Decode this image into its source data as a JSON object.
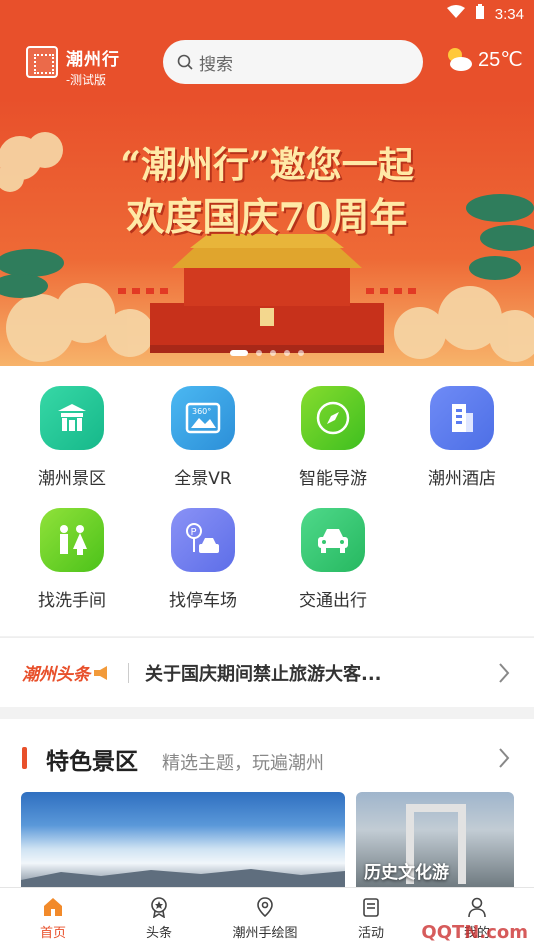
{
  "status_bar": {
    "time": "3:34"
  },
  "header": {
    "brand_title": "潮州行",
    "brand_subtitle": "-测试版",
    "search_placeholder": "搜索",
    "weather_temp": "25℃"
  },
  "banner": {
    "line1": "“潮州行”邀您一起",
    "line2": "欢度国庆70周年",
    "slide_count": 5,
    "active_slide": 1
  },
  "grid_items": [
    {
      "label": "潮州景区",
      "icon": "scenic-gate-icon",
      "color": "#22c497"
    },
    {
      "label": "全景VR",
      "icon": "vr-360-icon",
      "color": "#3fa6e8"
    },
    {
      "label": "智能导游",
      "icon": "compass-icon",
      "color": "#5bc828"
    },
    {
      "label": "潮州酒店",
      "icon": "hotel-building-icon",
      "color": "#5b7cf0"
    },
    {
      "label": "找洗手间",
      "icon": "restroom-icon",
      "color": "#64cc2a"
    },
    {
      "label": "找停车场",
      "icon": "parking-car-icon",
      "color": "#6f7ef0"
    },
    {
      "label": "交通出行",
      "icon": "car-icon",
      "color": "#34c870"
    }
  ],
  "news": {
    "tag": "潮州头条",
    "text": "关于国庆期间禁止旅游大客..."
  },
  "featured": {
    "title": "特色景区",
    "subtitle": "精选主题，玩遍潮州",
    "cards": [
      {
        "label": ""
      },
      {
        "label": "历史文化游"
      }
    ]
  },
  "tabbar": {
    "items": [
      {
        "label": "首页",
        "icon": "home-icon",
        "active": true
      },
      {
        "label": "头条",
        "icon": "news-badge-icon",
        "active": false
      },
      {
        "label": "潮州手绘图",
        "icon": "map-pin-icon",
        "active": false
      },
      {
        "label": "活动",
        "icon": "activity-icon",
        "active": false
      },
      {
        "label": "我的",
        "icon": "profile-icon",
        "active": false
      }
    ]
  },
  "watermark": "QQTN.com",
  "colors": {
    "primary": "#e8502b",
    "banner_text": "#ffe9a6"
  }
}
